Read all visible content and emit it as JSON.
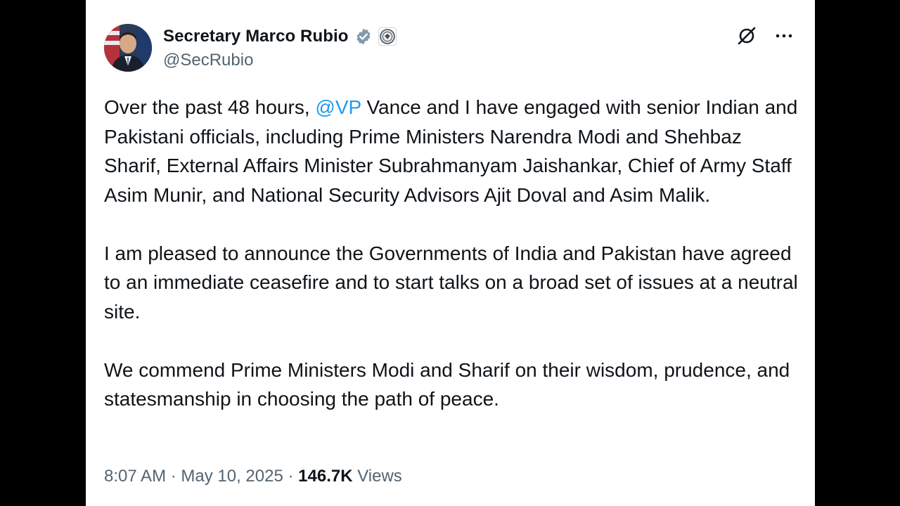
{
  "author": {
    "display_name": "Secretary Marco Rubio",
    "handle": "@SecRubio",
    "verified_badge_icon": "gray-verified-badge-icon",
    "affiliation_icon": "government-seal-icon"
  },
  "actions": {
    "grok_icon": "grok-icon",
    "more_icon": "more-options-icon"
  },
  "tweet": {
    "p1_before": "Over the past 48 hours, ",
    "p1_mention": "@VP",
    "p1_after": " Vance and I have engaged with senior Indian and Pakistani officials, including Prime Ministers Narendra Modi and Shehbaz Sharif, External Affairs Minister Subrahmanyam Jaishankar, Chief of Army Staff Asim Munir, and National Security Advisors Ajit Doval and Asim Malik.",
    "p2": "I am pleased to announce the Governments of India and Pakistan have agreed to an immediate ceasefire and to start talks on a broad set of issues at a neutral site.",
    "p3": "We commend Prime Ministers Modi and Sharif on their wisdom, prudence, and statesmanship in choosing the path of peace."
  },
  "meta": {
    "time": "8:07 AM",
    "separator": " · ",
    "date": "May 10, 2025",
    "views_count": "146.7K",
    "views_label": " Views"
  },
  "colors": {
    "text_primary": "#0f1419",
    "text_secondary": "#536471",
    "link": "#1d9bf0",
    "badge_gray": "#829aab"
  }
}
